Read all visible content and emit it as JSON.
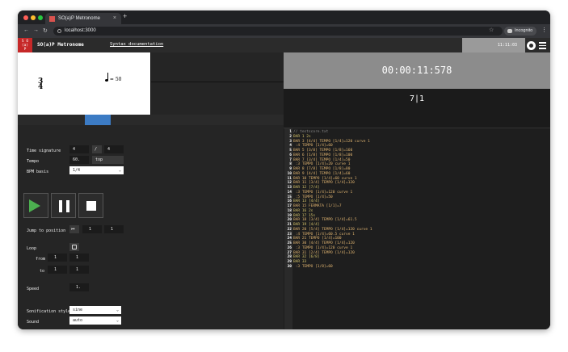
{
  "browser": {
    "tab_title": "SO(a)P Metronome",
    "tab_close": "×",
    "new_tab": "+",
    "url": "localhost:3000",
    "incognito_label": "Incognito",
    "nav_back": "←",
    "nav_forward": "→",
    "nav_reload": "↻",
    "star": "☆",
    "menu": "⋮"
  },
  "app": {
    "logo_lines": [
      "S O",
      "(a)",
      "P"
    ],
    "title": "SO(a)P Metronome",
    "syntax_link": "Syntax documentation",
    "header_time": "11:11:03",
    "accent": "#c62828"
  },
  "score": {
    "ts_top": "3",
    "ts_bottom": "4",
    "tempo_text": "= 50"
  },
  "settings": {
    "time_signature_label": "Time signature",
    "ts_numerator": "4",
    "ts_separator": "/",
    "ts_denominator": "4",
    "tempo_label": "Tempo",
    "tempo_value": "60.",
    "tempo_unit": "top",
    "bpm_basis_label": "BPM basis",
    "bpm_basis_value": "1/4"
  },
  "transport": {
    "jump_label": "Jump to position",
    "jump_bar": "1",
    "jump_beat": "1",
    "loop_label": "Loop",
    "from_label": "from",
    "from_bar": "1",
    "from_beat": "1",
    "to_label": "to",
    "to_bar": "1",
    "to_beat": "1",
    "speed_label": "Speed",
    "speed_value": "1."
  },
  "sound": {
    "sonification_label": "Sonification style",
    "sonification_value": "sine",
    "sound_label": "Sound",
    "sound_value": "auto"
  },
  "display": {
    "clock": "00:00:11:578",
    "bar_beat": "7|1"
  },
  "editor": {
    "lines": [
      "// testscore.txt",
      "BAR 1 2s",
      "BAR 3 [4/4] TEMPO [1/4]=120 curve 1",
      " :4 TEMPO [1/4]=60",
      "BAR 5 [3/8] TEMPO [1/8]=160",
      "BAR 6 [1/8] TEMPO [1/8]=100",
      "BAR 7 [3/4] TEMPO [1/4]=50",
      " :3 TEMPO [1/4]=20 curve 1",
      "BAR 8 [7/8] TEMPO [1/8]=80",
      "BAR 9 [4/4] TEMPO [1/4]=60",
      "BAR 10 TEMPO [1/4]=60 curve 1",
      "BAR 11 [3/4] TEMPO [1/4]=120",
      "BAR 12 [7/4]",
      " :3 TEMPO [1/4]=120 curve 1",
      " :5 TEMPO [1/4]=50",
      "BAR 13 [4/4]",
      "BAR 15 FERMATA [1/1]=7",
      "BAR 16 2s",
      "BAR 17 15s",
      "BAR 18 [3/4] TEMPO [1/4]=61.5",
      "BAR 19 [4/4]",
      "BAR 20 [5/4] TEMPO [1/4]=120 curve 1",
      " :4 TEMPO [1/4]=60.5 curve 1",
      "BAR 21 TEMPO [1/4]=100",
      "BAR 30 [4/4] TEMPO [1/4]=120",
      " :3 TEMPO [1/4]=120 curve 1",
      "BAR 31 [2/4] TEMPO [1/4]=120",
      "BAR 32 [6/8]",
      "BAR 33",
      " :3 TEMPO [1/8]=60"
    ]
  }
}
